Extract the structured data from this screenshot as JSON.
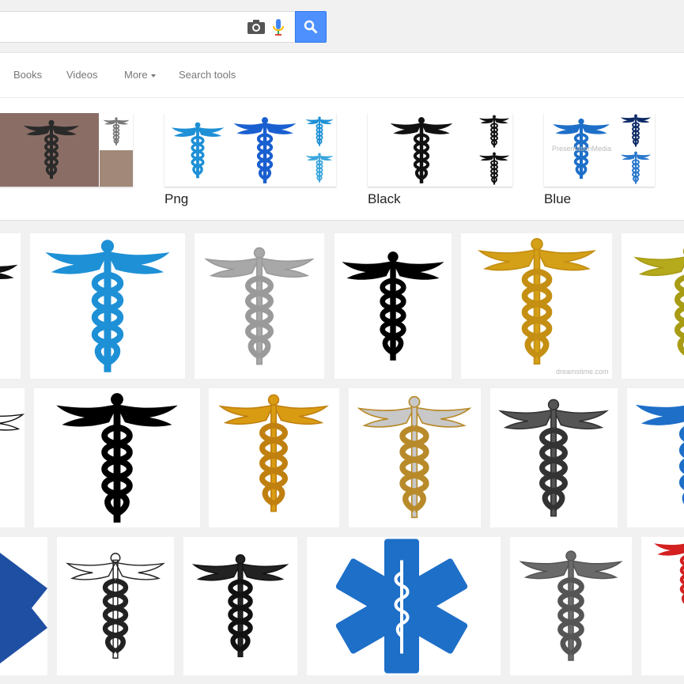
{
  "nav": {
    "books": "Books",
    "videos": "Videos",
    "more": "More",
    "search_tools": "Search tools"
  },
  "related": [
    {
      "label": "Png"
    },
    {
      "label": "Black"
    },
    {
      "label": "Blue"
    }
  ],
  "watermarks": {
    "presentation_media": "PresentationMedia",
    "dreamstime": "dreamstime.com"
  },
  "icons": [
    "camera-icon",
    "microphone-icon",
    "search-icon"
  ],
  "colors": {
    "search_button": "#4d90fe",
    "caduceus_blue": "#1e90d6",
    "caduceus_gold": "#d4a017",
    "star_of_life_blue": "#1e6fc8"
  }
}
